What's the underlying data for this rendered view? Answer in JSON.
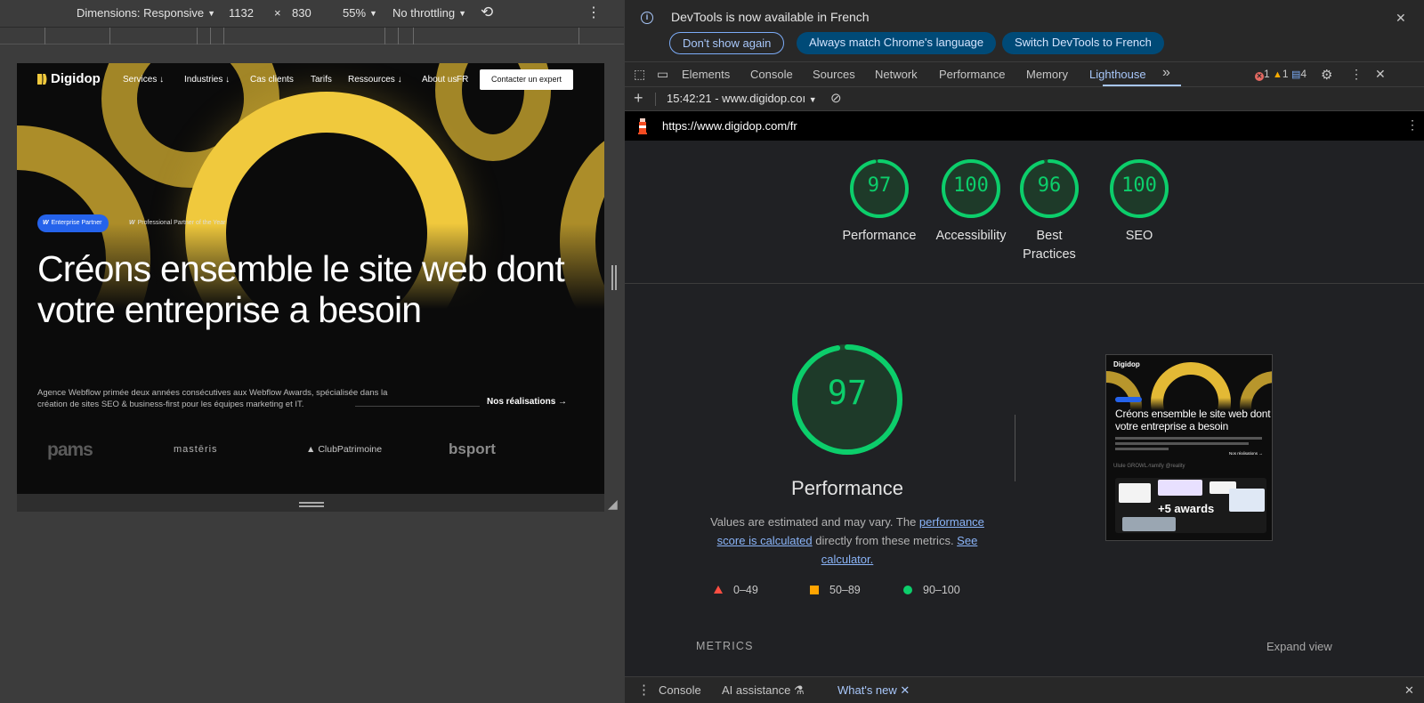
{
  "device_toolbar": {
    "dimensions_label": "Dimensions: Responsive",
    "width": "1132",
    "times": "×",
    "height": "830",
    "zoom": "55%",
    "throttling": "No throttling"
  },
  "site": {
    "logo_text": "Digidop",
    "nav": {
      "services": "Services",
      "industries": "Industries",
      "cas_clients": "Cas clients",
      "tarifs": "Tarifs",
      "ressources": "Ressources",
      "about": "About us",
      "lang": "FR",
      "cta": "Contacter un expert"
    },
    "badge_enterprise": "Enterprise Partner",
    "badge_partner": "Professional Partner of the Year",
    "hero_title": "Créons ensemble le site web dont votre entreprise a besoin",
    "hero_desc": "Agence Webflow primée deux années consécutives aux Webflow Awards, spécialisée dans la création de sites SEO & business-first pour les équipes marketing et IT.",
    "hero_link": "Nos réalisations →",
    "client_logos": [
      "pams",
      "mastēris",
      "ClubPatrimoine",
      "bsport"
    ]
  },
  "devtools": {
    "infobar": {
      "message": "DevTools is now available in French",
      "dont_show": "Don't show again",
      "always_match": "Always match Chrome's language",
      "switch": "Switch DevTools to French"
    },
    "tabs": [
      "Elements",
      "Console",
      "Sources",
      "Network",
      "Performance",
      "Memory",
      "Lighthouse"
    ],
    "more_tabs": "»",
    "counts": {
      "errors": "1",
      "warnings": "1",
      "messages": "4"
    },
    "lh_toolbar": {
      "report_select": "15:42:21 - www.digidop.coı"
    },
    "report_url": "https://www.digidop.com/fr",
    "scores": [
      {
        "label": "Performance",
        "score": "97",
        "value": 97
      },
      {
        "label": "Accessibility",
        "score": "100",
        "value": 100
      },
      {
        "label": "Best Practices",
        "score": "96",
        "value": 96
      },
      {
        "label": "SEO",
        "score": "100",
        "value": 100
      }
    ],
    "performance_detail": {
      "score": "97",
      "title": "Performance",
      "desc_prefix": "Values are estimated and may vary. The ",
      "desc_link1": "performance score is calculated",
      "desc_middle": " directly from these metrics. ",
      "desc_link2": "See calculator."
    },
    "legend": {
      "fail": "0–49",
      "average": "50–89",
      "pass": "90–100"
    },
    "metrics_label": "METRICS",
    "expand_view": "Expand view",
    "thumbnail": {
      "logo": "Digidop",
      "title": "Créons ensemble le site web dont votre entreprise a besoin",
      "link": "Nos réalisations →",
      "logos": "Ulule   GROWL   ∕ramify   @reality",
      "awards": "+5 awards"
    },
    "drawer": {
      "console": "Console",
      "ai": "AI assistance",
      "whats_new": "What's new"
    }
  },
  "colors": {
    "pass": "#0cce6b",
    "average": "#ffa400",
    "fail": "#ff4e42",
    "accent": "#a8c7fa",
    "brand_yellow": "#f0c93d"
  }
}
